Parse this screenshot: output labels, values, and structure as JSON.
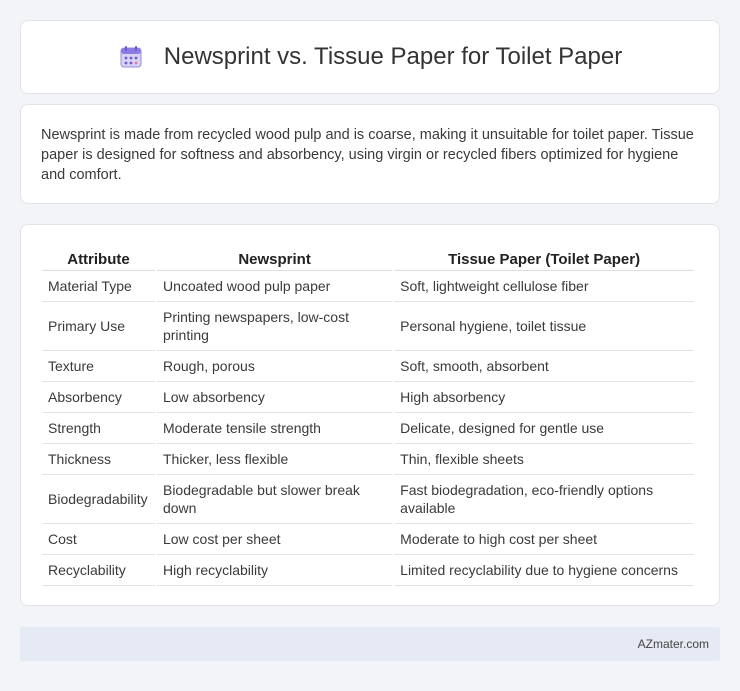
{
  "header": {
    "icon": "calendar-icon",
    "title": "Newsprint vs. Tissue Paper for Toilet Paper"
  },
  "intro": {
    "text": "Newsprint is made from recycled wood pulp and is coarse, making it unsuitable for toilet paper. Tissue paper is designed for softness and absorbency, using virgin or recycled fibers optimized for hygiene and comfort."
  },
  "table": {
    "headers": [
      "Attribute",
      "Newsprint",
      "Tissue Paper (Toilet Paper)"
    ],
    "rows": [
      [
        "Material Type",
        "Uncoated wood pulp paper",
        "Soft, lightweight cellulose fiber"
      ],
      [
        "Primary Use",
        "Printing newspapers, low-cost printing",
        "Personal hygiene, toilet tissue"
      ],
      [
        "Texture",
        "Rough, porous",
        "Soft, smooth, absorbent"
      ],
      [
        "Absorbency",
        "Low absorbency",
        "High absorbency"
      ],
      [
        "Strength",
        "Moderate tensile strength",
        "Delicate, designed for gentle use"
      ],
      [
        "Thickness",
        "Thicker, less flexible",
        "Thin, flexible sheets"
      ],
      [
        "Biodegradability",
        "Biodegradable but slower break down",
        "Fast biodegradation, eco-friendly options available"
      ],
      [
        "Cost",
        "Low cost per sheet",
        "Moderate to high cost per sheet"
      ],
      [
        "Recyclability",
        "High recyclability",
        "Limited recyclability due to hygiene concerns"
      ]
    ]
  },
  "footer": {
    "brand": "AZmater.com"
  }
}
